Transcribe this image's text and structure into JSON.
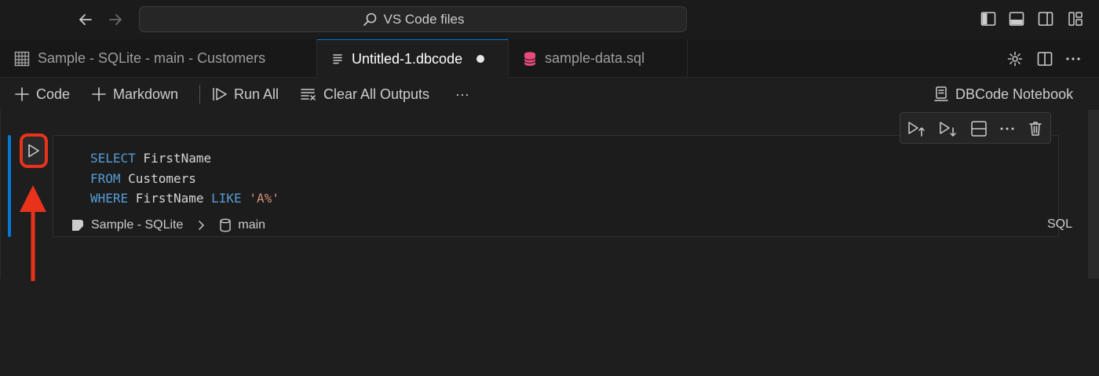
{
  "titlebar": {
    "search_text": "VS Code files",
    "back_icon": "arrow-left-icon",
    "forward_icon": "arrow-right-icon"
  },
  "tabs": [
    {
      "label": "Sample - SQLite - main - Customers",
      "icon": "table-grid-icon",
      "active": false
    },
    {
      "label": "Untitled-1.dbcode",
      "icon": "document-lines-icon",
      "active": true,
      "dirty": true
    },
    {
      "label": "sample-data.sql",
      "icon": "database-icon",
      "active": false
    }
  ],
  "toolbar": {
    "code_label": "Code",
    "markdown_label": "Markdown",
    "run_all_label": "Run All",
    "clear_outputs_label": "Clear All Outputs",
    "more_label": "···",
    "kernel_label": "DBCode Notebook"
  },
  "cell": {
    "code_lines": [
      {
        "kw": "SELECT",
        "rest": " FirstName"
      },
      {
        "kw": "FROM",
        "rest": " Customers"
      },
      {
        "kw": "WHERE",
        "rest": " FirstName ",
        "kw2": "LIKE",
        "str": "'A%'"
      }
    ],
    "connection": "Sample - SQLite",
    "schema": "main",
    "language": "SQL"
  },
  "colors": {
    "accent": "#0078d4",
    "annotation": "#e8321c",
    "keyword": "#569cd6",
    "string": "#ce9178"
  }
}
